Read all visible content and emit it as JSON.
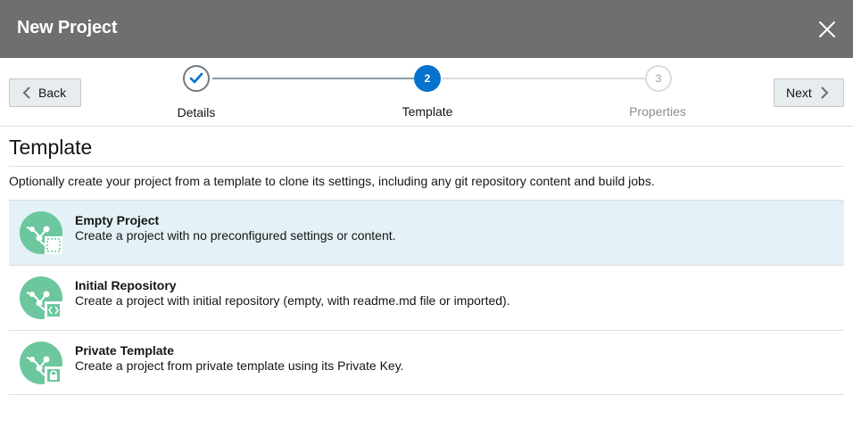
{
  "dialog": {
    "title": "New Project",
    "close_icon": "close-icon"
  },
  "navigation": {
    "back_label": "Back",
    "next_label": "Next"
  },
  "train": {
    "steps": [
      {
        "label": "Details",
        "state": "visited",
        "marker": "checkmark-icon"
      },
      {
        "label": "Template",
        "state": "current",
        "number": "2"
      },
      {
        "label": "Properties",
        "state": "future",
        "number": "3"
      }
    ]
  },
  "main": {
    "section_title": "Template",
    "description": "Optionally create your project from a template to clone its settings, including any git repository content and build jobs.",
    "templates": [
      {
        "name": "Empty Project",
        "description": "Create a project with no preconfigured settings or content.",
        "icon": "empty-project-icon",
        "selected": true
      },
      {
        "name": "Initial Repository",
        "description": "Create a project with initial repository (empty, with readme.md file or imported).",
        "icon": "initial-repository-icon",
        "selected": false
      },
      {
        "name": "Private Template",
        "description": "Create a project from private template using its Private Key.",
        "icon": "private-template-icon",
        "selected": false
      }
    ]
  },
  "colors": {
    "header_bg": "#6f6f6f",
    "current_step": "#0572ce",
    "selected_row": "#e4f1f7",
    "icon_green": "#6cc79e"
  }
}
